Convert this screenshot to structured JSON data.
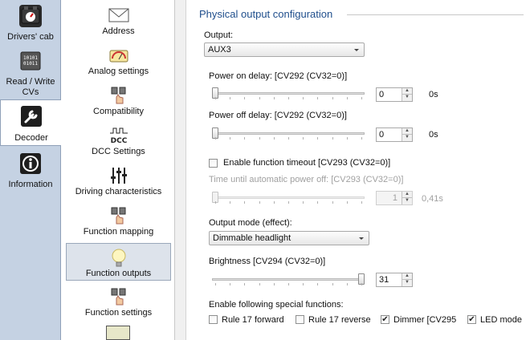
{
  "nav": {
    "items": [
      {
        "label": "Drivers' cab",
        "icon": "gauge-icon"
      },
      {
        "label": "Read / Write CVs",
        "icon": "binary-icon"
      },
      {
        "label": "Decoder",
        "icon": "wrench-icon",
        "active": true
      },
      {
        "label": "Information",
        "icon": "info-icon"
      }
    ]
  },
  "categories": [
    {
      "label": "Address",
      "icon": "envelope-icon"
    },
    {
      "label": "Analog settings",
      "icon": "meter-icon"
    },
    {
      "label": "Compatibility",
      "icon": "chip-hand-icon"
    },
    {
      "label": "DCC Settings",
      "icon": "dcc-icon",
      "icon_text": "DCC"
    },
    {
      "label": "Driving characteristics",
      "icon": "sliders-icon"
    },
    {
      "label": "Function mapping",
      "icon": "chip-hand-icon"
    },
    {
      "label": "Function outputs",
      "icon": "lightbulb-icon",
      "active": true
    },
    {
      "label": "Function settings",
      "icon": "chip-hand-icon"
    }
  ],
  "main": {
    "group_title": "Physical output configuration",
    "output_label": "Output:",
    "output_value": "AUX3",
    "power_on_label": "Power on delay: [CV292 (CV32=0)]",
    "power_on_value": "0",
    "power_on_unit": "0s",
    "power_on_level": 0.0,
    "power_off_label": "Power off delay: [CV292 (CV32=0)]",
    "power_off_value": "0",
    "power_off_unit": "0s",
    "power_off_level": 0.0,
    "enable_timeout_label": "Enable function timeout [CV293 (CV32=0)]",
    "enable_timeout_checked": false,
    "auto_off_label": "Time until automatic power off: [CV293 (CV32=0)]",
    "auto_off_value": "1",
    "auto_off_unit": "0,41s",
    "auto_off_level": 0.0,
    "output_mode_label": "Output mode (effect):",
    "output_mode_value": "Dimmable headlight",
    "brightness_label": "Brightness [CV294 (CV32=0)]",
    "brightness_value": "31",
    "brightness_level": 1.0,
    "special_label": "Enable following special functions:",
    "special": [
      {
        "label": "Rule 17 forward",
        "checked": false
      },
      {
        "label": "Rule 17 reverse",
        "checked": false
      },
      {
        "label": "Dimmer [CV295",
        "checked": true
      },
      {
        "label": "LED mode",
        "checked": true
      }
    ]
  },
  "colors": {
    "accent": "#1f4e8c",
    "nav_bg": "#c5d2e3",
    "selected_bg": "#dde3eb"
  }
}
